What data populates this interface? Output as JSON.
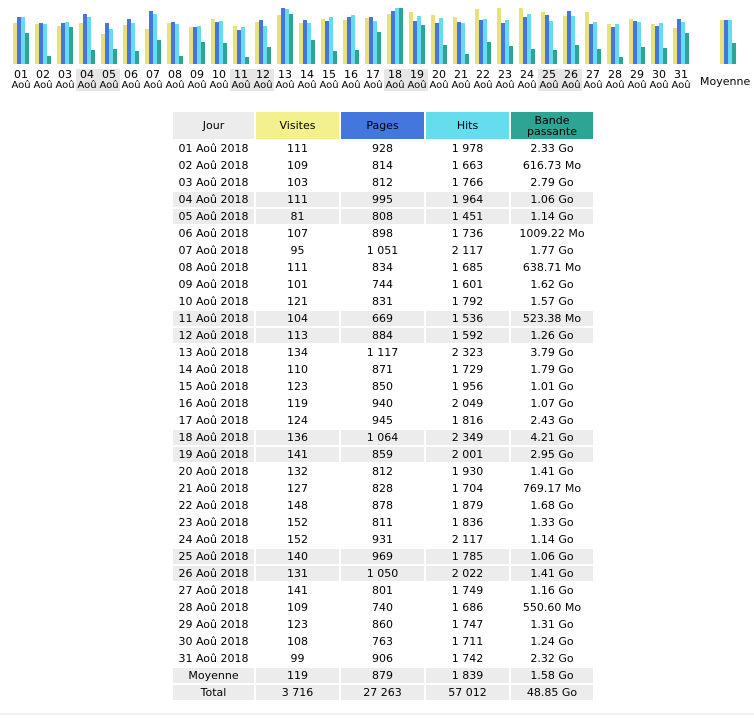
{
  "colors": {
    "visites": "#e8e07a",
    "pages": "#4477dd",
    "hits": "#66ddee",
    "bande": "#2ea495",
    "weekend_bg": "#ececec"
  },
  "chart_data": {
    "type": "bar",
    "categories": [
      "01",
      "02",
      "03",
      "04",
      "05",
      "06",
      "07",
      "08",
      "09",
      "10",
      "11",
      "12",
      "13",
      "14",
      "15",
      "16",
      "17",
      "18",
      "19",
      "20",
      "21",
      "22",
      "23",
      "24",
      "25",
      "26",
      "27",
      "28",
      "29",
      "30",
      "31"
    ],
    "category_sublabel": "Aoû",
    "weekend_days": [
      "04",
      "05",
      "11",
      "12",
      "18",
      "19",
      "25",
      "26"
    ],
    "average_label": "Moyenne",
    "series": [
      {
        "name": "Visites",
        "values": [
          111,
          109,
          103,
          111,
          81,
          107,
          95,
          111,
          101,
          121,
          104,
          113,
          134,
          110,
          123,
          119,
          124,
          136,
          141,
          132,
          127,
          148,
          152,
          152,
          140,
          131,
          141,
          109,
          123,
          108,
          99
        ],
        "average": 119
      },
      {
        "name": "Pages",
        "values": [
          928,
          814,
          812,
          995,
          808,
          898,
          1051,
          834,
          744,
          831,
          669,
          884,
          1117,
          871,
          850,
          940,
          945,
          1064,
          859,
          812,
          828,
          878,
          811,
          931,
          969,
          1050,
          801,
          740,
          860,
          763,
          906
        ],
        "average": 879
      },
      {
        "name": "Hits",
        "values": [
          1978,
          1663,
          1766,
          1964,
          1451,
          1736,
          2117,
          1685,
          1601,
          1792,
          1536,
          1592,
          2323,
          1729,
          1956,
          2049,
          1816,
          2349,
          2001,
          1930,
          1704,
          1879,
          1836,
          2117,
          1785,
          2022,
          1749,
          1686,
          1747,
          1711,
          1742
        ],
        "average": 1839
      },
      {
        "name": "Bande passante",
        "unit": "Go",
        "values": [
          2.33,
          0.602,
          2.79,
          1.06,
          1.14,
          0.985,
          1.77,
          0.624,
          1.62,
          1.57,
          0.511,
          1.26,
          3.79,
          1.79,
          1.01,
          1.07,
          2.43,
          4.21,
          2.95,
          1.41,
          0.751,
          1.68,
          1.33,
          1.14,
          1.06,
          1.41,
          1.16,
          0.538,
          1.31,
          1.24,
          2.32
        ],
        "average": 1.58
      }
    ]
  },
  "table": {
    "headers": {
      "jour": "Jour",
      "visites": "Visites",
      "pages": "Pages",
      "hits": "Hits",
      "bande_1": "Bande",
      "bande_2": "passante"
    },
    "rows": [
      {
        "jour": "01 Aoû 2018",
        "visites": "111",
        "pages": "928",
        "hits": "1 978",
        "bande": "2.33 Go",
        "weekend": false
      },
      {
        "jour": "02 Aoû 2018",
        "visites": "109",
        "pages": "814",
        "hits": "1 663",
        "bande": "616.73 Mo",
        "weekend": false
      },
      {
        "jour": "03 Aoû 2018",
        "visites": "103",
        "pages": "812",
        "hits": "1 766",
        "bande": "2.79 Go",
        "weekend": false
      },
      {
        "jour": "04 Aoû 2018",
        "visites": "111",
        "pages": "995",
        "hits": "1 964",
        "bande": "1.06 Go",
        "weekend": true
      },
      {
        "jour": "05 Aoû 2018",
        "visites": "81",
        "pages": "808",
        "hits": "1 451",
        "bande": "1.14 Go",
        "weekend": true
      },
      {
        "jour": "06 Aoû 2018",
        "visites": "107",
        "pages": "898",
        "hits": "1 736",
        "bande": "1009.22 Mo",
        "weekend": false
      },
      {
        "jour": "07 Aoû 2018",
        "visites": "95",
        "pages": "1 051",
        "hits": "2 117",
        "bande": "1.77 Go",
        "weekend": false
      },
      {
        "jour": "08 Aoû 2018",
        "visites": "111",
        "pages": "834",
        "hits": "1 685",
        "bande": "638.71 Mo",
        "weekend": false
      },
      {
        "jour": "09 Aoû 2018",
        "visites": "101",
        "pages": "744",
        "hits": "1 601",
        "bande": "1.62 Go",
        "weekend": false
      },
      {
        "jour": "10 Aoû 2018",
        "visites": "121",
        "pages": "831",
        "hits": "1 792",
        "bande": "1.57 Go",
        "weekend": false
      },
      {
        "jour": "11 Aoû 2018",
        "visites": "104",
        "pages": "669",
        "hits": "1 536",
        "bande": "523.38 Mo",
        "weekend": true
      },
      {
        "jour": "12 Aoû 2018",
        "visites": "113",
        "pages": "884",
        "hits": "1 592",
        "bande": "1.26 Go",
        "weekend": true
      },
      {
        "jour": "13 Aoû 2018",
        "visites": "134",
        "pages": "1 117",
        "hits": "2 323",
        "bande": "3.79 Go",
        "weekend": false
      },
      {
        "jour": "14 Aoû 2018",
        "visites": "110",
        "pages": "871",
        "hits": "1 729",
        "bande": "1.79 Go",
        "weekend": false
      },
      {
        "jour": "15 Aoû 2018",
        "visites": "123",
        "pages": "850",
        "hits": "1 956",
        "bande": "1.01 Go",
        "weekend": false
      },
      {
        "jour": "16 Aoû 2018",
        "visites": "119",
        "pages": "940",
        "hits": "2 049",
        "bande": "1.07 Go",
        "weekend": false
      },
      {
        "jour": "17 Aoû 2018",
        "visites": "124",
        "pages": "945",
        "hits": "1 816",
        "bande": "2.43 Go",
        "weekend": false
      },
      {
        "jour": "18 Aoû 2018",
        "visites": "136",
        "pages": "1 064",
        "hits": "2 349",
        "bande": "4.21 Go",
        "weekend": true
      },
      {
        "jour": "19 Aoû 2018",
        "visites": "141",
        "pages": "859",
        "hits": "2 001",
        "bande": "2.95 Go",
        "weekend": true
      },
      {
        "jour": "20 Aoû 2018",
        "visites": "132",
        "pages": "812",
        "hits": "1 930",
        "bande": "1.41 Go",
        "weekend": false
      },
      {
        "jour": "21 Aoû 2018",
        "visites": "127",
        "pages": "828",
        "hits": "1 704",
        "bande": "769.17 Mo",
        "weekend": false
      },
      {
        "jour": "22 Aoû 2018",
        "visites": "148",
        "pages": "878",
        "hits": "1 879",
        "bande": "1.68 Go",
        "weekend": false
      },
      {
        "jour": "23 Aoû 2018",
        "visites": "152",
        "pages": "811",
        "hits": "1 836",
        "bande": "1.33 Go",
        "weekend": false
      },
      {
        "jour": "24 Aoû 2018",
        "visites": "152",
        "pages": "931",
        "hits": "2 117",
        "bande": "1.14 Go",
        "weekend": false
      },
      {
        "jour": "25 Aoû 2018",
        "visites": "140",
        "pages": "969",
        "hits": "1 785",
        "bande": "1.06 Go",
        "weekend": true
      },
      {
        "jour": "26 Aoû 2018",
        "visites": "131",
        "pages": "1 050",
        "hits": "2 022",
        "bande": "1.41 Go",
        "weekend": true
      },
      {
        "jour": "27 Aoû 2018",
        "visites": "141",
        "pages": "801",
        "hits": "1 749",
        "bande": "1.16 Go",
        "weekend": false
      },
      {
        "jour": "28 Aoû 2018",
        "visites": "109",
        "pages": "740",
        "hits": "1 686",
        "bande": "550.60 Mo",
        "weekend": false
      },
      {
        "jour": "29 Aoû 2018",
        "visites": "123",
        "pages": "860",
        "hits": "1 747",
        "bande": "1.31 Go",
        "weekend": false
      },
      {
        "jour": "30 Aoû 2018",
        "visites": "108",
        "pages": "763",
        "hits": "1 711",
        "bande": "1.24 Go",
        "weekend": false
      },
      {
        "jour": "31 Aoû 2018",
        "visites": "99",
        "pages": "906",
        "hits": "1 742",
        "bande": "2.32 Go",
        "weekend": false
      }
    ],
    "moyenne": {
      "jour": "Moyenne",
      "visites": "119",
      "pages": "879",
      "hits": "1 839",
      "bande": "1.58 Go"
    },
    "total": {
      "jour": "Total",
      "visites": "3 716",
      "pages": "27 263",
      "hits": "57 012",
      "bande": "48.85 Go"
    }
  }
}
